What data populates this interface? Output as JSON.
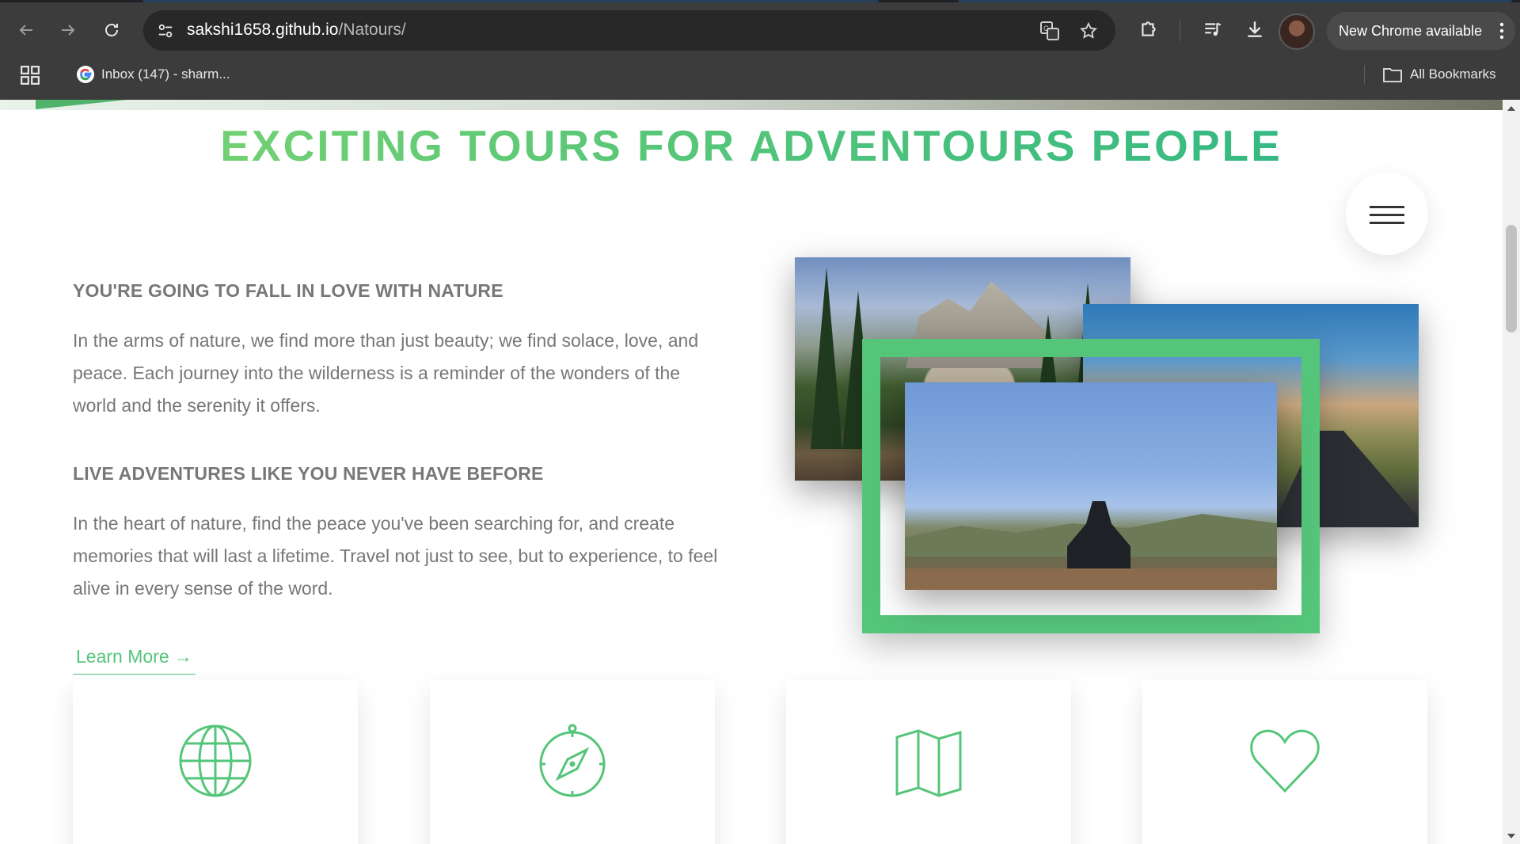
{
  "browser": {
    "url_host": "sakshi1658.github.io",
    "url_path": "/Natours/",
    "update_label": "New Chrome available",
    "bookmarks": [
      {
        "label": "Inbox (147) - sharm...",
        "icon": "google-icon"
      }
    ],
    "all_bookmarks_label": "All Bookmarks"
  },
  "page": {
    "headline": "EXCITING TOURS FOR ADVENTOURS PEOPLE",
    "features": [
      {
        "heading": "YOU'RE GOING TO FALL IN LOVE WITH NATURE",
        "text": "In the arms of nature, we find more than just beauty; we find solace, love, and peace. Each journey into the wilderness is a reminder of the wonders of the world and the serenity it offers."
      },
      {
        "heading": "LIVE ADVENTURES LIKE YOU NEVER HAVE BEFORE",
        "text": "In the heart of nature, find the peace you've been searching for, and create memories that will last a lifetime. Travel not just to see, but to experience, to feel alive in every sense of the word."
      }
    ],
    "learn_more": "Learn More →",
    "cards": [
      {
        "icon": "globe-icon"
      },
      {
        "icon": "compass-icon"
      },
      {
        "icon": "map-icon"
      },
      {
        "icon": "heart-icon"
      }
    ]
  },
  "colors": {
    "primary_green": "#55c57a",
    "gradient_light": "#7ed56f",
    "gradient_dark": "#28b485",
    "text_grey": "#777777",
    "chrome_dark": "#3c3c3c"
  }
}
